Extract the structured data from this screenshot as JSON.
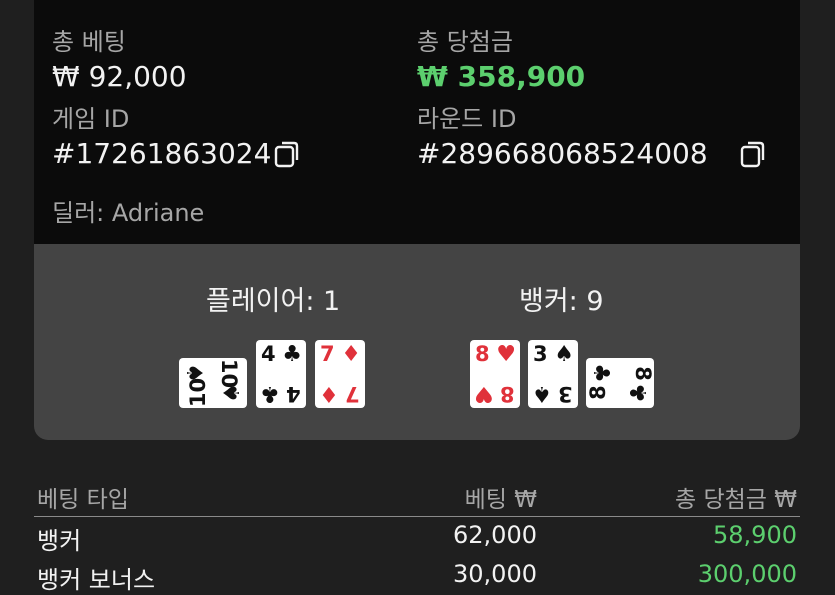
{
  "summary": {
    "total_bet_label": "총 베팅",
    "total_bet_value": "₩ 92,000",
    "total_win_label": "총 당첨금",
    "total_win_value": "₩ 358,900",
    "game_id_label": "게임 ID",
    "game_id_value": "#17261863024",
    "round_id_label": "라운드 ID",
    "round_id_value": "#289668068524008",
    "dealer_text": "딜러: Adriane"
  },
  "hands": {
    "player_title": "플레이어: 1",
    "banker_title": "뱅커: 9",
    "player_cards": [
      {
        "rank": "10",
        "suit": "♠",
        "color": "black"
      },
      {
        "rank": "4",
        "suit": "♣",
        "color": "black"
      },
      {
        "rank": "7",
        "suit": "♦",
        "color": "red"
      }
    ],
    "banker_cards": [
      {
        "rank": "8",
        "suit": "♥",
        "color": "red"
      },
      {
        "rank": "3",
        "suit": "♠",
        "color": "black"
      },
      {
        "rank": "8",
        "suit": "♣",
        "color": "black"
      }
    ]
  },
  "table": {
    "headers": [
      "베팅 타입",
      "베팅 ₩",
      "총 당첨금 ₩"
    ],
    "rows": [
      {
        "type": "뱅커",
        "bet": "62,000",
        "win": "58,900"
      },
      {
        "type": "뱅커 보너스",
        "bet": "30,000",
        "win": "300,000"
      }
    ]
  },
  "colors": {
    "win_green": "#5ccf6e",
    "card_red": "#e0313a",
    "info_bg": "#0b0b0b",
    "cards_bg": "#444444",
    "page_bg": "#1f1f1f"
  }
}
